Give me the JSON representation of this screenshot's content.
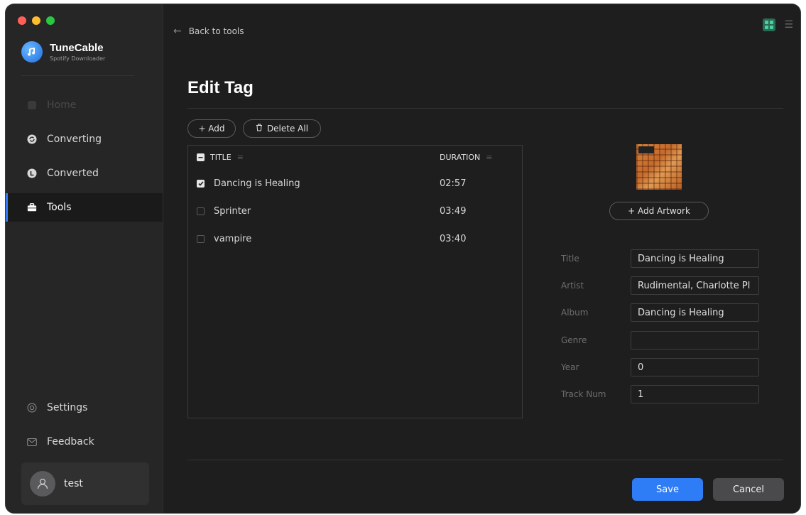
{
  "app": {
    "name": "TuneCable",
    "subtitle": "Spotify Downloader"
  },
  "sidebar": {
    "items": [
      {
        "label": "Home",
        "icon": "home-icon",
        "state": "disabled"
      },
      {
        "label": "Converting",
        "icon": "converting-icon",
        "state": "normal"
      },
      {
        "label": "Converted",
        "icon": "converted-icon",
        "state": "normal"
      },
      {
        "label": "Tools",
        "icon": "toolbox-icon",
        "state": "active"
      }
    ],
    "settings_label": "Settings",
    "feedback_label": "Feedback",
    "user_name": "test"
  },
  "header": {
    "back_label": "Back to tools"
  },
  "page": {
    "title": "Edit Tag"
  },
  "toolbar": {
    "add_label": "+ Add",
    "delete_all_label": "Delete All"
  },
  "table": {
    "col_title": "TITLE",
    "col_duration": "DURATION",
    "rows": [
      {
        "title": "Dancing is Healing",
        "duration": "02:57",
        "checked": true
      },
      {
        "title": "Sprinter",
        "duration": "03:49",
        "checked": false
      },
      {
        "title": "vampire",
        "duration": "03:40",
        "checked": false
      }
    ]
  },
  "artwork": {
    "add_label": "+ Add Artwork"
  },
  "fields": {
    "title_label": "Title",
    "title_value": "Dancing is Healing",
    "artist_label": "Artist",
    "artist_value": "Rudimental, Charlotte Pl",
    "album_label": "Album",
    "album_value": "Dancing is Healing",
    "genre_label": "Genre",
    "genre_value": "",
    "year_label": "Year",
    "year_value": "0",
    "track_label": "Track Num",
    "track_value": "1"
  },
  "actions": {
    "save_label": "Save",
    "cancel_label": "Cancel"
  },
  "colors": {
    "accent": "#2f7df6",
    "background": "#1e1e1f",
    "sidebar": "#262627"
  }
}
